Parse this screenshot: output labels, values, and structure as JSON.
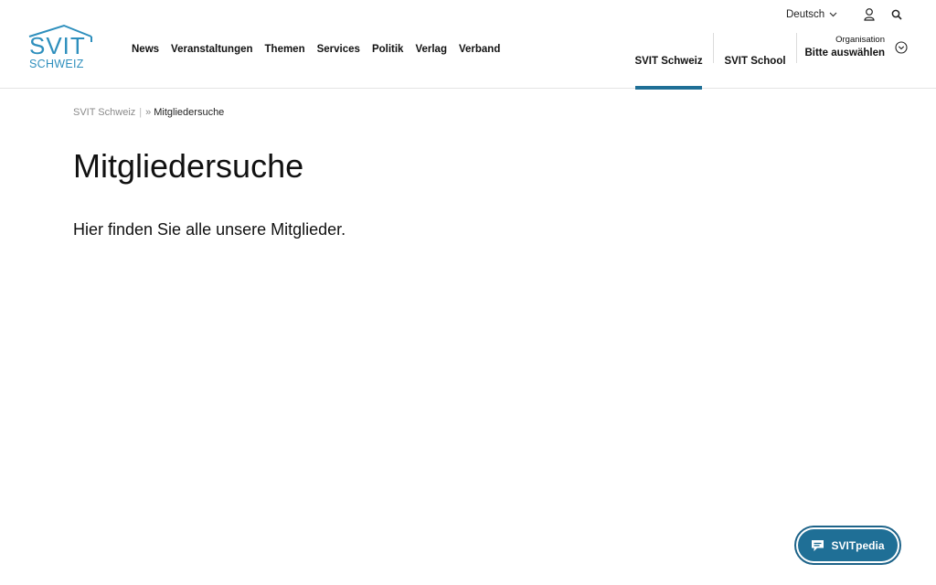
{
  "brand": {
    "logo_line1": "SVIT",
    "logo_line2": "SCHWEIZ",
    "accent_color": "#2e8fbd",
    "primary_color": "#1f6f96"
  },
  "header": {
    "nav": [
      "News",
      "Veranstaltungen",
      "Themen",
      "Services",
      "Politik",
      "Verlag",
      "Verband"
    ],
    "language": "Deutsch",
    "icons": {
      "user": "user-icon",
      "search": "search-icon",
      "language_dropdown": "chevron-down-icon"
    },
    "site_tabs": [
      {
        "label": "SVIT Schweiz",
        "active": true
      },
      {
        "label": "SVIT School",
        "active": false
      }
    ],
    "organisation": {
      "small_label": "Organisation",
      "value": "Bitte auswählen",
      "icon": "chevron-circle-down-icon"
    }
  },
  "breadcrumb": {
    "home": "SVIT Schweiz",
    "separator": "|",
    "arrow": "»",
    "current": "Mitgliedersuche"
  },
  "main": {
    "title": "Mitgliedersuche",
    "intro": "Hier finden Sie alle unsere Mitglieder."
  },
  "floating_button": {
    "label": "SVITpedia",
    "icon": "chat-bubble-icon"
  }
}
